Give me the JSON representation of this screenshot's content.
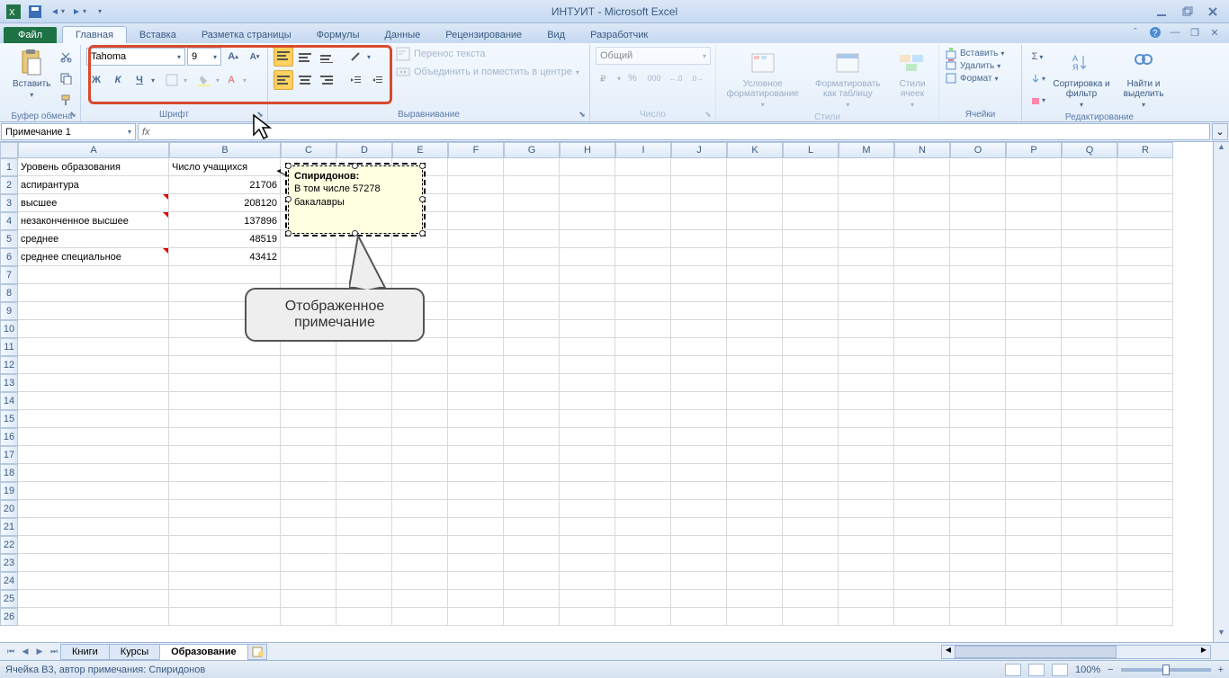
{
  "title": "ИНТУИТ - Microsoft Excel",
  "tabs": {
    "file": "Файл",
    "items": [
      "Главная",
      "Вставка",
      "Разметка страницы",
      "Формулы",
      "Данные",
      "Рецензирование",
      "Вид",
      "Разработчик"
    ],
    "active": 0
  },
  "ribbon": {
    "clipboard": {
      "label": "Буфер обмена",
      "paste": "Вставить"
    },
    "font": {
      "label": "Шрифт",
      "name": "Tahoma",
      "size": "9",
      "bold": "Ж",
      "italic": "К",
      "underline": "Ч"
    },
    "align": {
      "label": "Выравнивание",
      "wrap": "Перенос текста",
      "merge": "Объединить и поместить в центре"
    },
    "number": {
      "label": "Число",
      "format": "Общий"
    },
    "styles": {
      "label": "Стили",
      "cond": "Условное форматирование",
      "table": "Форматировать как таблицу",
      "cell": "Стили ячеек"
    },
    "cells": {
      "label": "Ячейки",
      "insert": "Вставить",
      "delete": "Удалить",
      "format": "Формат"
    },
    "editing": {
      "label": "Редактирование",
      "sort": "Сортировка и фильтр",
      "find": "Найти и выделить"
    }
  },
  "namebox": "Примечание 1",
  "columns": [
    "A",
    "B",
    "C",
    "D",
    "E",
    "F",
    "G",
    "H",
    "I",
    "J",
    "K",
    "L",
    "M",
    "N",
    "O",
    "P",
    "Q",
    "R"
  ],
  "col_widths": {
    "A": 168,
    "B": 124,
    "default": 62
  },
  "rows_shown": 26,
  "data": {
    "A1": "Уровень образования",
    "B1": "Число учащихся",
    "A2": "аспирантура",
    "B2": "21706",
    "A3": "высшее",
    "B3": "208120",
    "A4": "незаконченное высшее",
    "B4": "137896",
    "A5": "среднее",
    "B5": "48519",
    "A6": "среднее специальное",
    "B6": "43412"
  },
  "comment_indicators": [
    "A3",
    "A4",
    "A6"
  ],
  "comment": {
    "author": "Спиридонов:",
    "text": "В том числе 57278 бакалавры"
  },
  "callout": "Отображенное примечание",
  "sheets": {
    "items": [
      "Книги",
      "Курсы",
      "Образование"
    ],
    "active": 2
  },
  "status": {
    "text": "Ячейка B3, автор примечания: Спиридонов",
    "zoom": "100%"
  }
}
